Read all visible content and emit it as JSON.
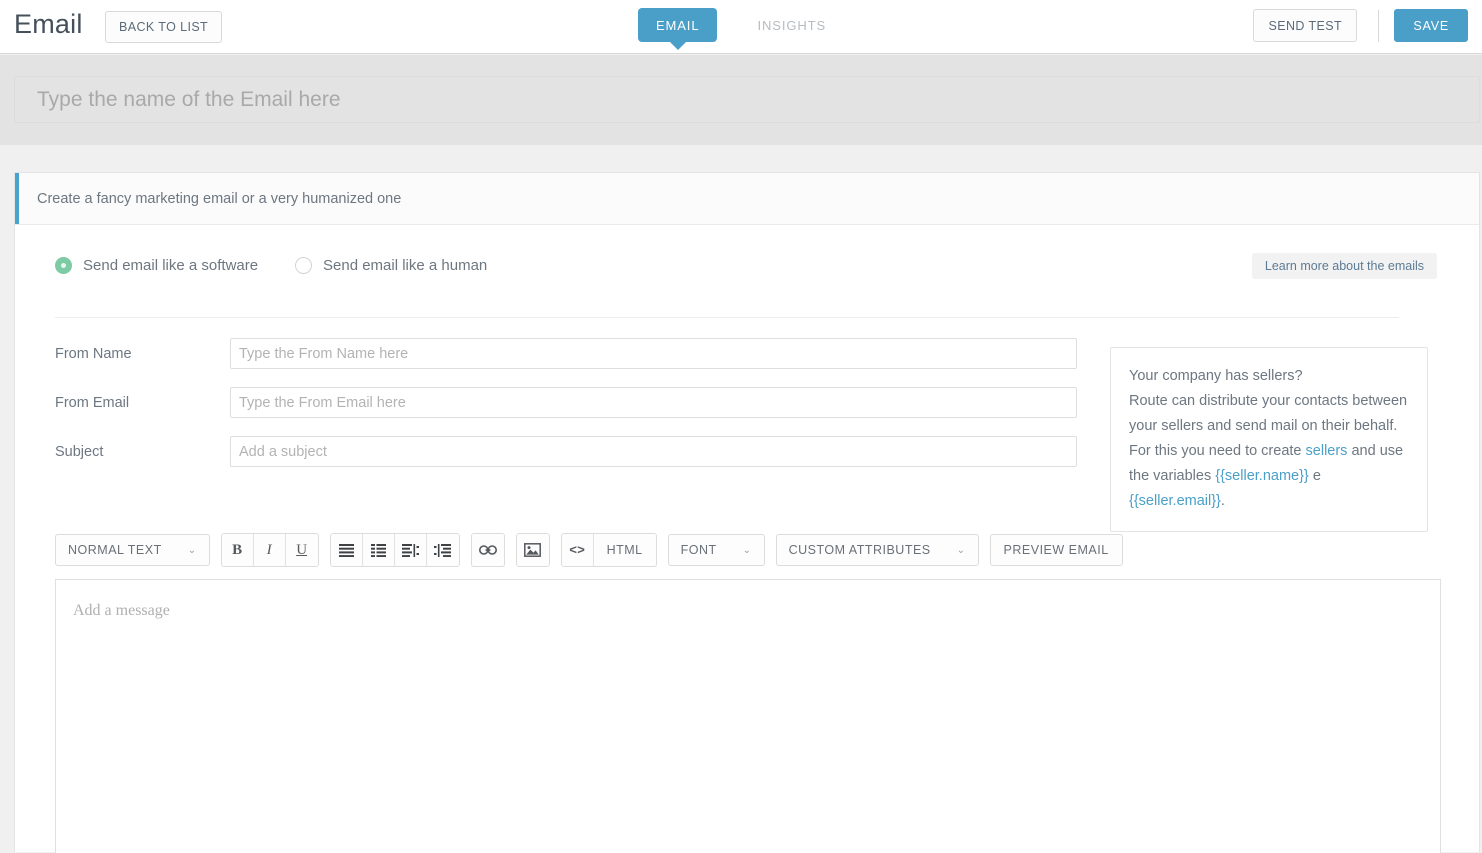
{
  "header": {
    "title": "Email",
    "back_label": "BACK TO LIST",
    "tabs": [
      {
        "label": "EMAIL",
        "active": true
      },
      {
        "label": "INSIGHTS",
        "active": false
      }
    ],
    "send_test_label": "SEND TEST",
    "save_label": "SAVE",
    "accent_color": "#4a9fc9"
  },
  "name_field": {
    "value": "",
    "placeholder": "Type the name of the Email here"
  },
  "banner": {
    "text": "Create a fancy marketing email or a very humanized one",
    "accent_color": "#4aa3cc"
  },
  "send_mode": {
    "options": [
      {
        "label": "Send email like a software",
        "selected": true
      },
      {
        "label": "Send email like a human",
        "selected": false
      }
    ],
    "selected_color": "#7ecaa5",
    "learn_more_label": "Learn more about the emails"
  },
  "form": {
    "fields": [
      {
        "label": "From Name",
        "value": "",
        "placeholder": "Type the From Name here"
      },
      {
        "label": "From Email",
        "value": "",
        "placeholder": "Type the From Email here"
      },
      {
        "label": "Subject",
        "value": "",
        "placeholder": "Add a subject"
      }
    ]
  },
  "sellers_box": {
    "line1": "Your company has sellers?",
    "line2": "Route can distribute your contacts between your sellers and send mail on their behalf. For this you need to create",
    "link_sellers": "sellers",
    "mid_text": "and use the variables",
    "var_name": "{{seller.name}}",
    "conjunction": "e",
    "var_email": "{{seller.email}}",
    "period": ".",
    "link_color": "#4a9fc9"
  },
  "toolbar": {
    "style_select": "NORMAL TEXT",
    "bold_label": "B",
    "italic_label": "I",
    "underline_label": "U",
    "bullet_list_icon": "bullet-list-icon",
    "numbered_list_icon": "numbered-list-icon",
    "outdent_icon": "outdent-icon",
    "indent_icon": "indent-icon",
    "link_icon": "link-icon",
    "image_icon": "image-icon",
    "code_label": "<>",
    "html_label": "HTML",
    "font_label": "FONT",
    "custom_attributes_label": "CUSTOM ATTRIBUTES",
    "preview_email_label": "PREVIEW EMAIL",
    "caret_glyph": "⌄"
  },
  "editor": {
    "placeholder": "Add a message",
    "value": ""
  }
}
